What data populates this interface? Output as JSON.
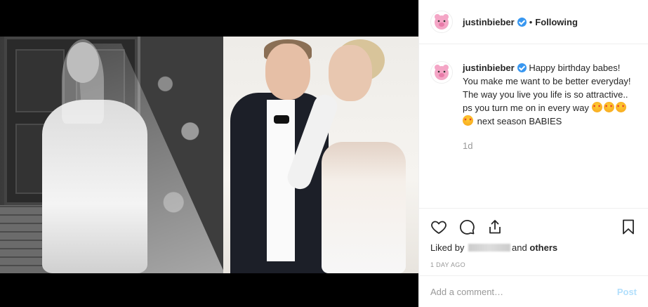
{
  "header": {
    "username": "justinbieber",
    "separator": "•",
    "follow_state": "Following"
  },
  "caption": {
    "username": "justinbieber",
    "text_1": "Happy birthday babes! You make me want to be better everyday! The way you live you life is so attractive.. ps you turn me on in every way",
    "emoji_name": "star-struck-emoji",
    "text_2": "next season BABIES",
    "time": "1d"
  },
  "actions": {
    "like_icon": "heart-icon",
    "comment_icon": "comment-icon",
    "share_icon": "share-icon",
    "save_icon": "bookmark-icon"
  },
  "likes": {
    "prefix": "Liked by",
    "middle": "and",
    "others": "others"
  },
  "posted_ago": "1 DAY AGO",
  "add_comment": {
    "placeholder": "Add a comment…",
    "post_label": "Post"
  },
  "colors": {
    "verified": "#3897f0",
    "post_disabled": "#b2dffc",
    "muted_text": "#999999"
  }
}
